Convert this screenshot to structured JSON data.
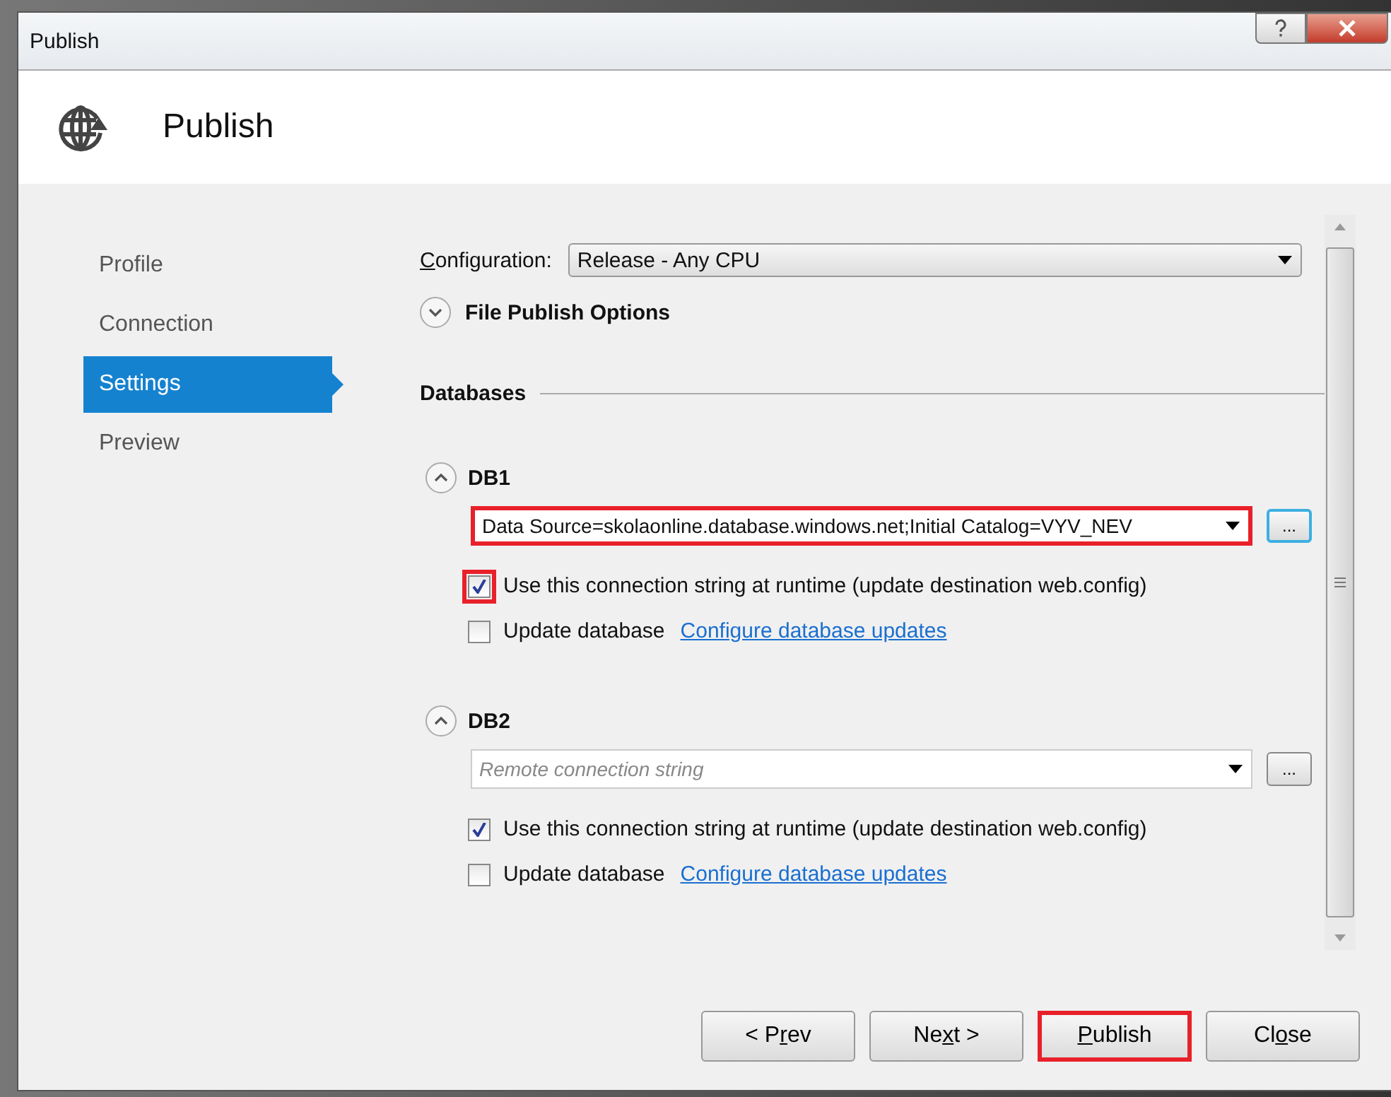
{
  "window": {
    "title": "Publish"
  },
  "header": {
    "title": "Publish"
  },
  "nav": [
    {
      "label": "Profile",
      "selected": false
    },
    {
      "label": "Connection",
      "selected": false
    },
    {
      "label": "Settings",
      "selected": true
    },
    {
      "label": "Preview",
      "selected": false
    }
  ],
  "configuration": {
    "label": {
      "key": "C",
      "after": "onfiguration:"
    },
    "value": "Release - Any CPU"
  },
  "file_publish_options": {
    "label": "File Publish Options",
    "expanded": false
  },
  "databases": {
    "heading": "Databases",
    "items": [
      {
        "name": "DB1",
        "expanded": true,
        "connection": {
          "value": "Data Source=skolaonline.database.windows.net;Initial Catalog=VYV_NEV",
          "highlighted": true
        },
        "browse": {
          "label": "...",
          "focused": true
        },
        "options": [
          {
            "kind": "runtime",
            "label": "Use this connection string at runtime (update destination web.config)",
            "checked": true,
            "highlighted": true
          },
          {
            "kind": "update",
            "label": "Update database",
            "checked": false,
            "highlighted": false,
            "link": "Configure database updates"
          }
        ]
      },
      {
        "name": "DB2",
        "expanded": true,
        "connection": {
          "placeholder": "Remote connection string",
          "highlighted": false
        },
        "browse": {
          "label": "...",
          "focused": false
        },
        "options": [
          {
            "kind": "runtime",
            "label": "Use this connection string at runtime (update destination web.config)",
            "checked": true,
            "highlighted": false
          },
          {
            "kind": "update",
            "label": "Update database",
            "checked": false,
            "highlighted": false,
            "link": "Configure database updates"
          }
        ]
      }
    ]
  },
  "buttons": [
    {
      "label": {
        "before": "< P",
        "key": "r",
        "after": "ev"
      },
      "highlighted": false
    },
    {
      "label": {
        "before": "Ne",
        "key": "x",
        "after": "t >"
      },
      "highlighted": false
    },
    {
      "label": {
        "key": "P",
        "after": "ublish"
      },
      "highlighted": true
    },
    {
      "label": {
        "before": "Cl",
        "key": "o",
        "after": "se"
      },
      "highlighted": false
    }
  ]
}
